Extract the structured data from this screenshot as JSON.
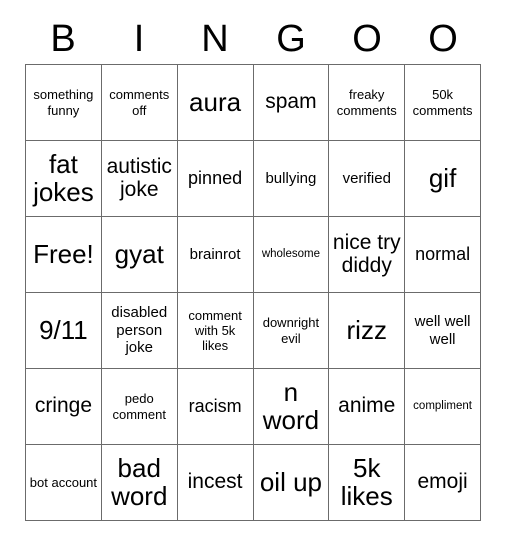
{
  "card": {
    "title": "BINGOO",
    "header_letters": [
      "B",
      "I",
      "N",
      "G",
      "O",
      "O"
    ],
    "rows": [
      [
        {
          "text": "something funny",
          "size": "fs-s"
        },
        {
          "text": "comments off",
          "size": "fs-s"
        },
        {
          "text": "aura",
          "size": "fs-xxl"
        },
        {
          "text": "spam",
          "size": "fs-xl"
        },
        {
          "text": "freaky comments",
          "size": "fs-s"
        },
        {
          "text": "50k comments",
          "size": "fs-s"
        }
      ],
      [
        {
          "text": "fat jokes",
          "size": "fs-xxl"
        },
        {
          "text": "autistic joke",
          "size": "fs-xl"
        },
        {
          "text": "pinned",
          "size": "fs-l"
        },
        {
          "text": "bullying",
          "size": "fs-m"
        },
        {
          "text": "verified",
          "size": "fs-m"
        },
        {
          "text": "gif",
          "size": "fs-xxl"
        }
      ],
      [
        {
          "text": "Free!",
          "size": "fs-xxl"
        },
        {
          "text": "gyat",
          "size": "fs-xxl"
        },
        {
          "text": "brainrot",
          "size": "fs-m"
        },
        {
          "text": "wholesome",
          "size": "fs-xs"
        },
        {
          "text": "nice try diddy",
          "size": "fs-xl"
        },
        {
          "text": "normal",
          "size": "fs-l"
        }
      ],
      [
        {
          "text": "9/11",
          "size": "fs-xxl"
        },
        {
          "text": "disabled person joke",
          "size": "fs-m"
        },
        {
          "text": "comment with 5k likes",
          "size": "fs-s"
        },
        {
          "text": "downright evil",
          "size": "fs-s"
        },
        {
          "text": "rizz",
          "size": "fs-xxl"
        },
        {
          "text": "well well well",
          "size": "fs-m"
        }
      ],
      [
        {
          "text": "cringe",
          "size": "fs-xl"
        },
        {
          "text": "pedo comment",
          "size": "fs-s"
        },
        {
          "text": "racism",
          "size": "fs-l"
        },
        {
          "text": "n word",
          "size": "fs-xxl"
        },
        {
          "text": "anime",
          "size": "fs-xl"
        },
        {
          "text": "compliment",
          "size": "fs-xs"
        }
      ],
      [
        {
          "text": "bot account",
          "size": "fs-s"
        },
        {
          "text": "bad word",
          "size": "fs-xxl"
        },
        {
          "text": "incest",
          "size": "fs-xl"
        },
        {
          "text": "oil up",
          "size": "fs-xxl"
        },
        {
          "text": "5k likes",
          "size": "fs-xxl"
        },
        {
          "text": "emoji",
          "size": "fs-xl"
        }
      ]
    ],
    "free_space": "Free!",
    "colors": {
      "background": "#ffffff",
      "text": "#000000",
      "border": "#6b6b6b"
    }
  }
}
